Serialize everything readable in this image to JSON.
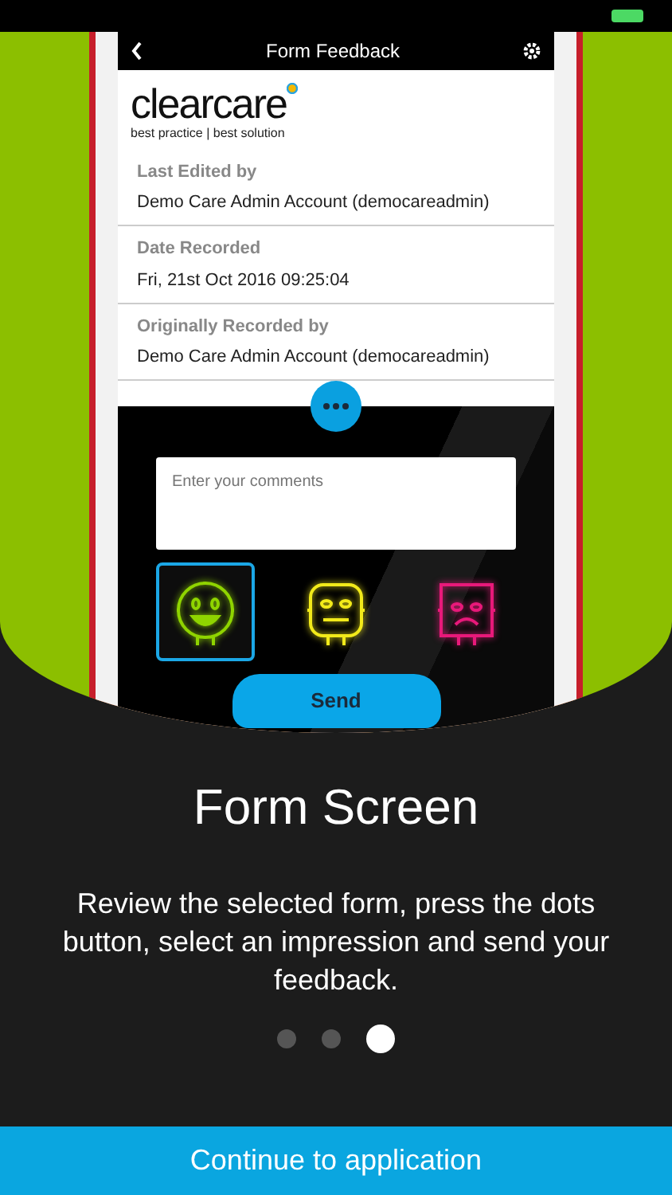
{
  "app_screen": {
    "title": "Form Feedback",
    "logo": {
      "name": "**clear**care",
      "tagline": "best practice | best solution"
    },
    "fields": [
      {
        "label": "Last Edited by",
        "value": "Demo Care Admin Account  (democareadmin)"
      },
      {
        "label": "Date Recorded",
        "value": "Fri, 21st Oct 2016   09:25:04"
      },
      {
        "label": "Originally Recorded by",
        "value": "Demo Care Admin Account  (democareadmin)"
      }
    ],
    "comment": {
      "placeholder": "Enter your comments"
    },
    "impressions": [
      {
        "kind": "happy",
        "color": "#8fd400",
        "selected": true
      },
      {
        "kind": "neutral",
        "color": "#f2ea1a",
        "selected": false
      },
      {
        "kind": "sad",
        "color": "#e8197a",
        "selected": false
      }
    ],
    "send_button": "Send"
  },
  "heading": "Form Screen",
  "description": "Review the selected form, press the dots button, select an impression and send your feedback.",
  "pages": [
    {
      "selected": false
    },
    {
      "selected": false
    },
    {
      "selected": true
    }
  ],
  "continue_button": "Continue to application"
}
